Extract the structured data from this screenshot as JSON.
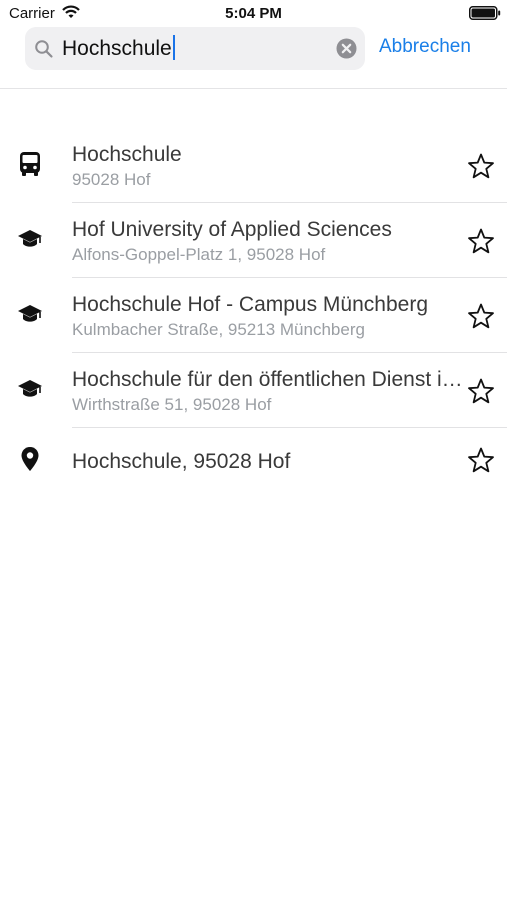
{
  "status_bar": {
    "carrier": "Carrier",
    "time": "5:04 PM",
    "icons": [
      "wifi-icon",
      "battery-icon"
    ]
  },
  "search": {
    "value": "Hochschule",
    "cancel_label": "Abbrechen",
    "icons": [
      "search-icon",
      "clear-icon"
    ]
  },
  "results": [
    {
      "title": "Hochschule",
      "subtitle": "95028 Hof",
      "icon": "bus-icon"
    },
    {
      "title": "Hof University of Applied Sciences",
      "subtitle": "Alfons-Goppel-Platz 1, 95028 Hof",
      "icon": "graduation-cap-icon"
    },
    {
      "title": "Hochschule Hof - Campus Münchberg",
      "subtitle": "Kulmbacher Straße, 95213 Münchberg",
      "icon": "graduation-cap-icon"
    },
    {
      "title": "Hochschule für den öffentlichen Dienst in Bayern",
      "subtitle": "Wirthstraße 51, 95028 Hof",
      "icon": "graduation-cap-icon"
    },
    {
      "title": "Hochschule, 95028 Hof",
      "subtitle": "",
      "icon": "map-pin-icon"
    }
  ],
  "favorite_icon": "star-outline-icon",
  "colors": {
    "accent": "#1a7fe8",
    "subtitle": "#9a9ea3",
    "search_bg": "#f0f0f2"
  }
}
